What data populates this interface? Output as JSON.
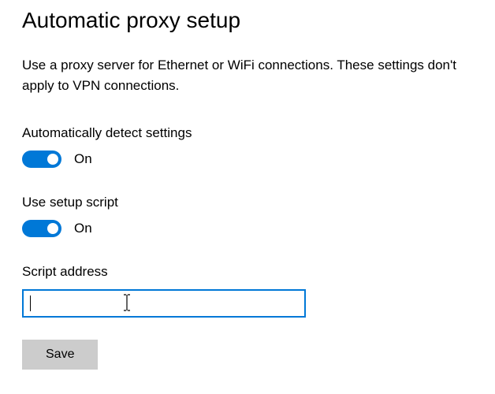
{
  "title": "Automatic proxy setup",
  "description": "Use a proxy server for Ethernet or WiFi connections. These settings don't apply to VPN connections.",
  "settings": {
    "auto_detect": {
      "label": "Automatically detect settings",
      "state_label": "On",
      "enabled": true,
      "accent_color": "#0078d7"
    },
    "use_script": {
      "label": "Use setup script",
      "state_label": "On",
      "enabled": true,
      "accent_color": "#0078d7"
    }
  },
  "script_address": {
    "label": "Script address",
    "value": "",
    "placeholder": ""
  },
  "buttons": {
    "save": "Save"
  }
}
